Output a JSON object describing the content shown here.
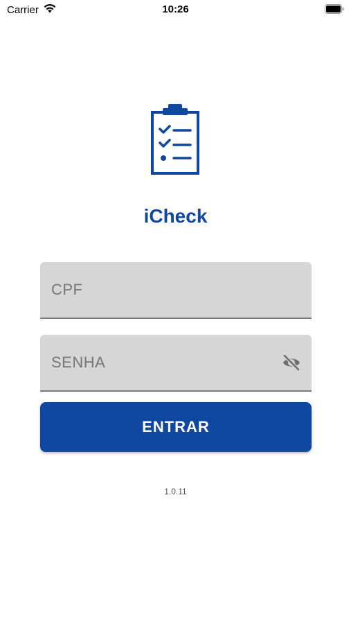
{
  "status_bar": {
    "carrier": "Carrier",
    "time": "10:26",
    "wifi_icon": "wifi-icon",
    "battery_icon": "battery-icon"
  },
  "app": {
    "logo_icon": "clipboard-checklist-icon",
    "title": "iCheck",
    "brand_color": "#0f47a1"
  },
  "login_form": {
    "cpf_placeholder": "CPF",
    "cpf_value": "",
    "senha_placeholder": "SENHA",
    "senha_value": "",
    "password_toggle_icon": "eye-off-icon",
    "submit_label": "ENTRAR"
  },
  "footer": {
    "version": "1.0.11"
  }
}
